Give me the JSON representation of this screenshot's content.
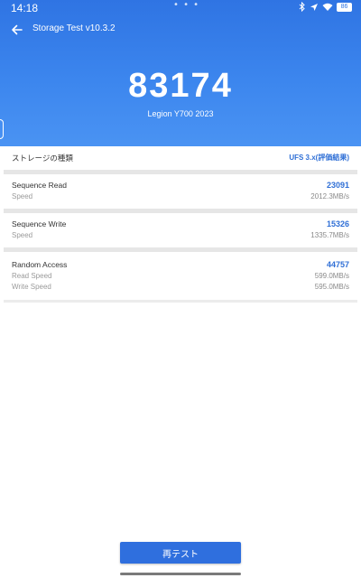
{
  "status_bar": {
    "time": "14:18",
    "dots": "• • •",
    "battery": "86"
  },
  "app_bar": {
    "title": "Storage Test v10.3.2"
  },
  "result": {
    "score": "83174",
    "device": "Legion Y700 2023"
  },
  "storage_type": {
    "label": "ストレージの種類",
    "value": "UFS 3.x(評価結果)"
  },
  "sequence_read": {
    "label": "Sequence Read",
    "score": "23091",
    "speed_label": "Speed",
    "speed": "2012.3MB/s"
  },
  "sequence_write": {
    "label": "Sequence Write",
    "score": "15326",
    "speed_label": "Speed",
    "speed": "1335.7MB/s"
  },
  "random_access": {
    "label": "Random Access",
    "score": "44757",
    "read_label": "Read Speed",
    "read_speed": "599.0MB/s",
    "write_label": "Write Speed",
    "write_speed": "595.0MB/s"
  },
  "actions": {
    "retest": "再テスト"
  },
  "colors": {
    "header_blue": "#3c86ee",
    "accent_blue": "#2f6fd6",
    "button_blue": "#2f6fde"
  }
}
